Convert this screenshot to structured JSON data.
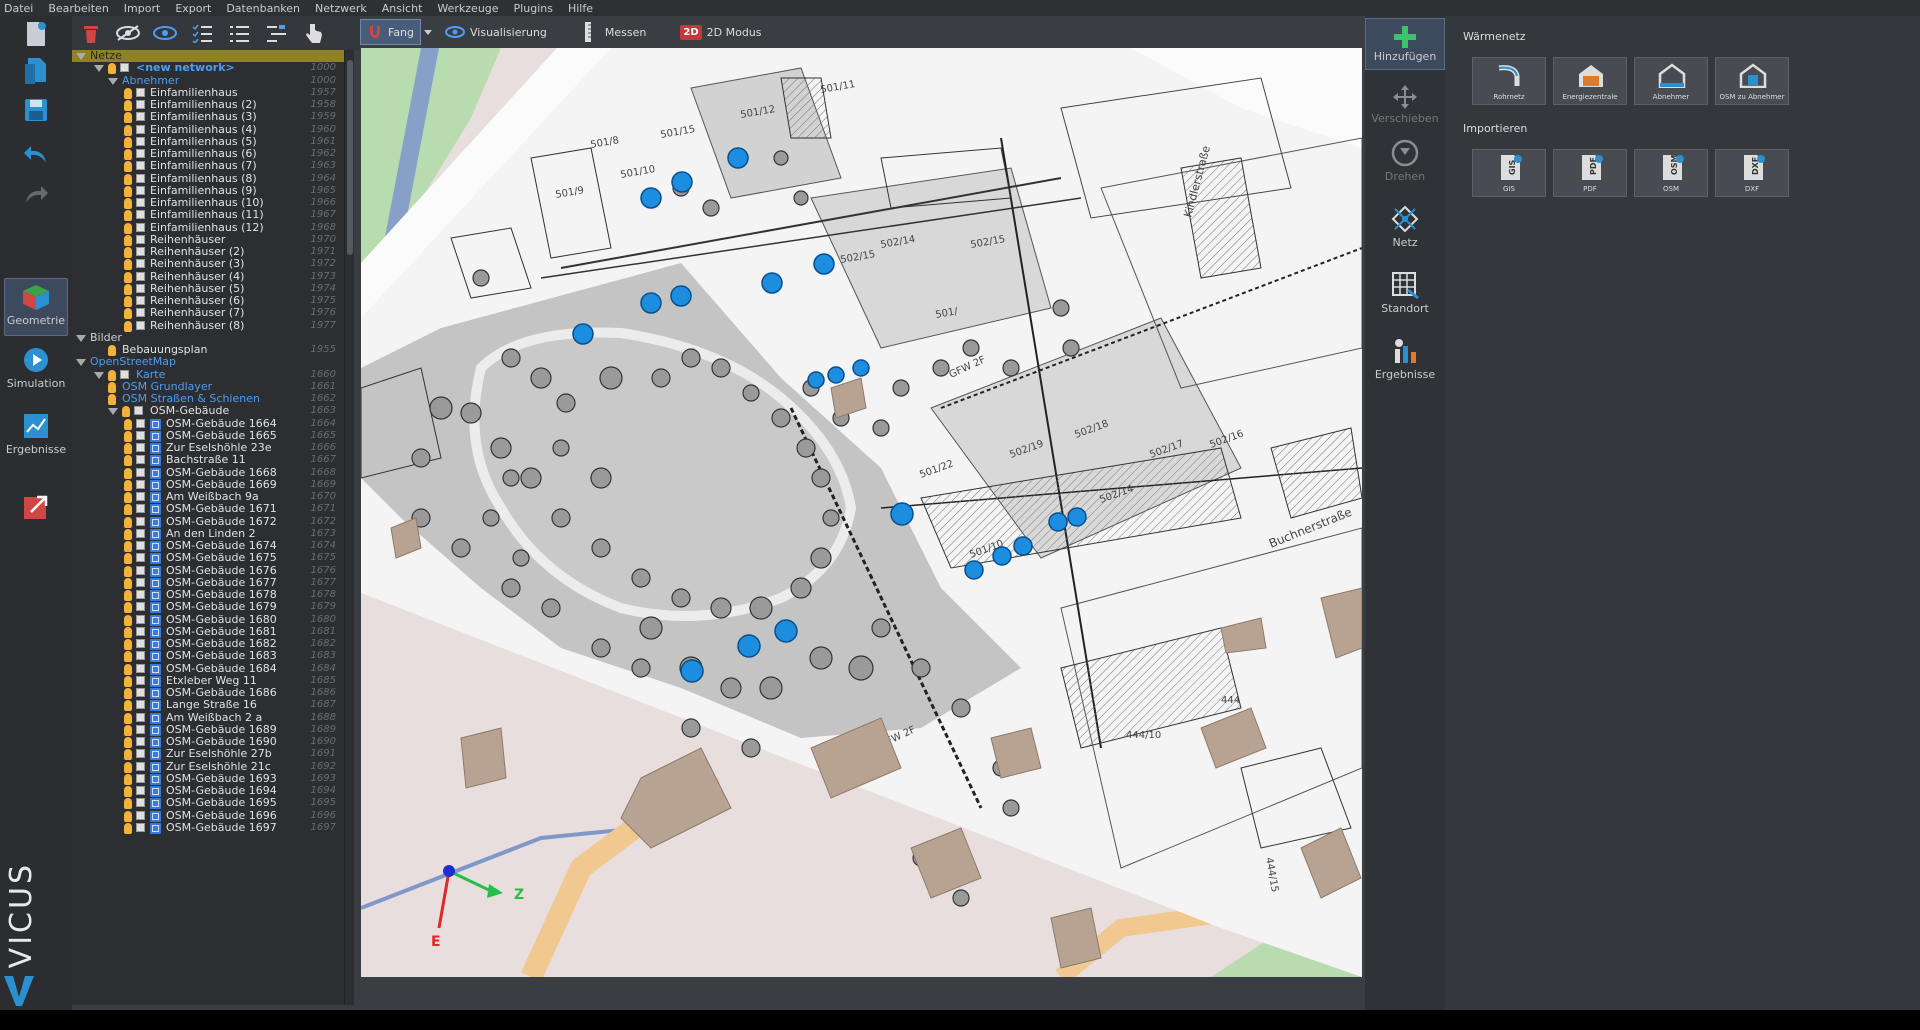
{
  "menu": [
    "Datei",
    "Bearbeiten",
    "Import",
    "Export",
    "Datenbanken",
    "Netzwerk",
    "Ansicht",
    "Werkzeuge",
    "Plugins",
    "Hilfe"
  ],
  "left_nav": {
    "geometry": "Geometrie",
    "simulation": "Simulation",
    "results": "Ergebnisse"
  },
  "brand": "VICUS",
  "view_toolbar": {
    "snap": "Fang",
    "visualization": "Visualisierung",
    "measure": "Messen",
    "mode2d": "2D Modus",
    "mode2d_icon": "2D"
  },
  "tree": [
    {
      "level": 0,
      "type": "cat",
      "name": "Netze",
      "id": "",
      "selected": true
    },
    {
      "level": 1,
      "type": "net",
      "name": "<new network>",
      "id": "1000"
    },
    {
      "level": 2,
      "type": "group",
      "name": "Abnehmer",
      "id": "1000"
    },
    {
      "level": 3,
      "type": "item",
      "name": "Einfamilienhaus",
      "id": "1957"
    },
    {
      "level": 3,
      "type": "item",
      "name": "Einfamilienhaus (2)",
      "id": "1958"
    },
    {
      "level": 3,
      "type": "item",
      "name": "Einfamilienhaus (3)",
      "id": "1959"
    },
    {
      "level": 3,
      "type": "item",
      "name": "Einfamilienhaus (4)",
      "id": "1960"
    },
    {
      "level": 3,
      "type": "item",
      "name": "Einfamilienhaus (5)",
      "id": "1961"
    },
    {
      "level": 3,
      "type": "item",
      "name": "Einfamilienhaus (6)",
      "id": "1962"
    },
    {
      "level": 3,
      "type": "item",
      "name": "Einfamilienhaus (7)",
      "id": "1963"
    },
    {
      "level": 3,
      "type": "item",
      "name": "Einfamilienhaus (8)",
      "id": "1964"
    },
    {
      "level": 3,
      "type": "item",
      "name": "Einfamilienhaus (9)",
      "id": "1965"
    },
    {
      "level": 3,
      "type": "item",
      "name": "Einfamilienhaus (10)",
      "id": "1966"
    },
    {
      "level": 3,
      "type": "item",
      "name": "Einfamilienhaus (11)",
      "id": "1967"
    },
    {
      "level": 3,
      "type": "item",
      "name": "Einfamilienhaus (12)",
      "id": "1968"
    },
    {
      "level": 3,
      "type": "item",
      "name": "Reihenhäuser",
      "id": "1970"
    },
    {
      "level": 3,
      "type": "item",
      "name": "Reihenhäuser (2)",
      "id": "1971"
    },
    {
      "level": 3,
      "type": "item",
      "name": "Reihenhäuser (3)",
      "id": "1972"
    },
    {
      "level": 3,
      "type": "item",
      "name": "Reihenhäuser (4)",
      "id": "1973"
    },
    {
      "level": 3,
      "type": "item",
      "name": "Reihenhäuser (5)",
      "id": "1974"
    },
    {
      "level": 3,
      "type": "item",
      "name": "Reihenhäuser (6)",
      "id": "1975"
    },
    {
      "level": 3,
      "type": "item",
      "name": "Reihenhäuser (7)",
      "id": "1976"
    },
    {
      "level": 3,
      "type": "item",
      "name": "Reihenhäuser (8)",
      "id": "1977"
    },
    {
      "level": 0,
      "type": "cat",
      "name": "Bilder",
      "id": ""
    },
    {
      "level": 2,
      "type": "img",
      "name": "Bebauungsplan",
      "id": "1955"
    },
    {
      "level": 0,
      "type": "catlink",
      "name": "OpenStreetMap",
      "id": ""
    },
    {
      "level": 1,
      "type": "net",
      "name": "Karte",
      "id": "1660",
      "link": true
    },
    {
      "level": 2,
      "type": "link",
      "name": "OSM Grundlayer",
      "id": "1661"
    },
    {
      "level": 2,
      "type": "link",
      "name": "OSM Straßen & Schienen",
      "id": "1662"
    },
    {
      "level": 2,
      "type": "group2",
      "name": "OSM-Gebäude",
      "id": "1663"
    },
    {
      "level": 3,
      "type": "bld",
      "name": "OSM-Gebäude 1664",
      "id": "1664"
    },
    {
      "level": 3,
      "type": "bld",
      "name": "OSM-Gebäude 1665",
      "id": "1665"
    },
    {
      "level": 3,
      "type": "bld",
      "name": "Zur Eselshöhle 23e",
      "id": "1666"
    },
    {
      "level": 3,
      "type": "bld",
      "name": "Bachstraße 11",
      "id": "1667"
    },
    {
      "level": 3,
      "type": "bld",
      "name": "OSM-Gebäude 1668",
      "id": "1668"
    },
    {
      "level": 3,
      "type": "bld",
      "name": "OSM-Gebäude 1669",
      "id": "1669"
    },
    {
      "level": 3,
      "type": "bld",
      "name": "Am Weißbach 9a",
      "id": "1670"
    },
    {
      "level": 3,
      "type": "bld",
      "name": "OSM-Gebäude 1671",
      "id": "1671"
    },
    {
      "level": 3,
      "type": "bld",
      "name": "OSM-Gebäude 1672",
      "id": "1672"
    },
    {
      "level": 3,
      "type": "bld",
      "name": "An den Linden 2",
      "id": "1673"
    },
    {
      "level": 3,
      "type": "bld",
      "name": "OSM-Gebäude 1674",
      "id": "1674"
    },
    {
      "level": 3,
      "type": "bld",
      "name": "OSM-Gebäude 1675",
      "id": "1675"
    },
    {
      "level": 3,
      "type": "bld",
      "name": "OSM-Gebäude 1676",
      "id": "1676"
    },
    {
      "level": 3,
      "type": "bld",
      "name": "OSM-Gebäude 1677",
      "id": "1677"
    },
    {
      "level": 3,
      "type": "bld",
      "name": "OSM-Gebäude 1678",
      "id": "1678"
    },
    {
      "level": 3,
      "type": "bld",
      "name": "OSM-Gebäude 1679",
      "id": "1679"
    },
    {
      "level": 3,
      "type": "bld",
      "name": "OSM-Gebäude 1680",
      "id": "1680"
    },
    {
      "level": 3,
      "type": "bld",
      "name": "OSM-Gebäude 1681",
      "id": "1681"
    },
    {
      "level": 3,
      "type": "bld",
      "name": "OSM-Gebäude 1682",
      "id": "1682"
    },
    {
      "level": 3,
      "type": "bld",
      "name": "OSM-Gebäude 1683",
      "id": "1683"
    },
    {
      "level": 3,
      "type": "bld",
      "name": "OSM-Gebäude 1684",
      "id": "1684"
    },
    {
      "level": 3,
      "type": "bld",
      "name": "Etxleber Weg 11",
      "id": "1685"
    },
    {
      "level": 3,
      "type": "bld",
      "name": "OSM-Gebäude 1686",
      "id": "1686"
    },
    {
      "level": 3,
      "type": "bld",
      "name": "Lange Straße 16",
      "id": "1687"
    },
    {
      "level": 3,
      "type": "bld",
      "name": "Am Weißbach 2 a",
      "id": "1688"
    },
    {
      "level": 3,
      "type": "bld",
      "name": "OSM-Gebäude 1689",
      "id": "1689"
    },
    {
      "level": 3,
      "type": "bld",
      "name": "OSM-Gebäude 1690",
      "id": "1690"
    },
    {
      "level": 3,
      "type": "bld",
      "name": "Zur Eselshöhle 27b",
      "id": "1691"
    },
    {
      "level": 3,
      "type": "bld",
      "name": "Zur Eselshöhle 21c",
      "id": "1692"
    },
    {
      "level": 3,
      "type": "bld",
      "name": "OSM-Gebäude 1693",
      "id": "1693"
    },
    {
      "level": 3,
      "type": "bld",
      "name": "OSM-Gebäude 1694",
      "id": "1694"
    },
    {
      "level": 3,
      "type": "bld",
      "name": "OSM-Gebäude 1695",
      "id": "1695"
    },
    {
      "level": 3,
      "type": "bld",
      "name": "OSM-Gebäude 1696",
      "id": "1696"
    },
    {
      "level": 3,
      "type": "bld",
      "name": "OSM-Gebäude 1697",
      "id": "1697"
    }
  ],
  "right_tools": {
    "add": "Hinzufügen",
    "move": "Verschieben",
    "rotate": "Drehen",
    "network": "Netz",
    "location": "Standort",
    "results": "Ergebnisse"
  },
  "panel": {
    "section_heat": "Wärmenetz",
    "heat_tiles": [
      "Rohrnetz",
      "Energiezentrale",
      "Abnehmer",
      "OSM zu Abnehmer"
    ],
    "section_import": "Importieren",
    "import_tiles": [
      "GIS",
      "PDF",
      "OSM",
      "DXF"
    ]
  },
  "map": {
    "axis_labels": {
      "x": "Z",
      "y": "E"
    },
    "street": "Buchnerstraße",
    "street2": "Kindlerstraße",
    "parcels": [
      "501/8",
      "501/12",
      "501/15",
      "501/10",
      "501/9",
      "501/11",
      "502/15",
      "502/14",
      "502/15",
      "501/",
      "501/22",
      "502/19",
      "502/18",
      "502/17",
      "502/16",
      "502/14",
      "501/10",
      "444",
      "444/10",
      "444/15",
      "GFW 2F",
      "GFW 2F"
    ]
  },
  "colors": {
    "accent": "#2b8fd0",
    "node": "#1d8de0",
    "bulb": "#f2b23a",
    "tree_link": "#4f9df0"
  }
}
